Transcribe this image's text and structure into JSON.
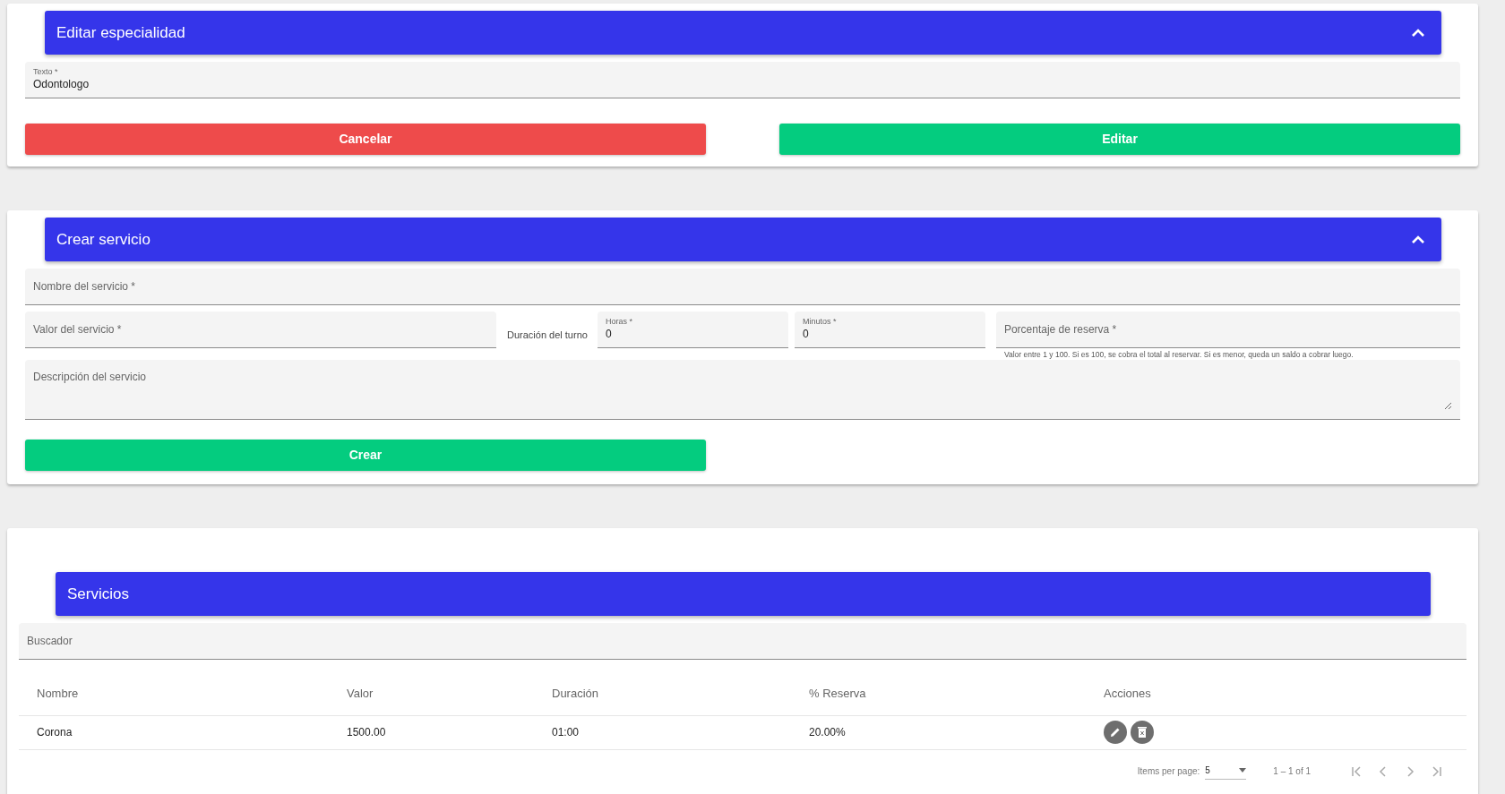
{
  "edit_card": {
    "title": "Editar especialidad",
    "expanded": true,
    "field": {
      "label": "Texto *",
      "value": "Odontologo"
    },
    "buttons": [
      {
        "label": "Cancelar",
        "kind": "danger"
      },
      {
        "label": "Editar",
        "kind": "success"
      }
    ]
  },
  "create_card": {
    "title": "Crear servicio",
    "expanded": true,
    "name_field": {
      "placeholder": "Nombre del servicio *"
    },
    "value_field": {
      "placeholder": "Valor del servicio *"
    },
    "duration_label": "Duración del turno",
    "hours_field": {
      "label": "Horas *",
      "value": "0"
    },
    "minutes_field": {
      "label": "Minutos *",
      "value": "0"
    },
    "percent_field": {
      "placeholder": "Porcentaje de reserva *",
      "hint": "Valor entre 1 y 100. Si es 100, se cobra el total al reservar. Si es menor, queda un saldo a cobrar luego."
    },
    "description_field": {
      "placeholder": "Descripción del servicio"
    },
    "submit": "Crear"
  },
  "services": {
    "title": "Servicios",
    "search": {
      "placeholder": "Buscador"
    },
    "table": {
      "columns": [
        "Nombre",
        "Valor",
        "Duración",
        "% Reserva",
        "Acciones"
      ],
      "rows": [
        {
          "cells": [
            "Corona",
            "1500.00",
            "01:00",
            "20.00%"
          ]
        }
      ]
    },
    "paginator": {
      "items_label": "Items per page:",
      "page_size": "5",
      "range": "1 – 1 of 1"
    }
  }
}
